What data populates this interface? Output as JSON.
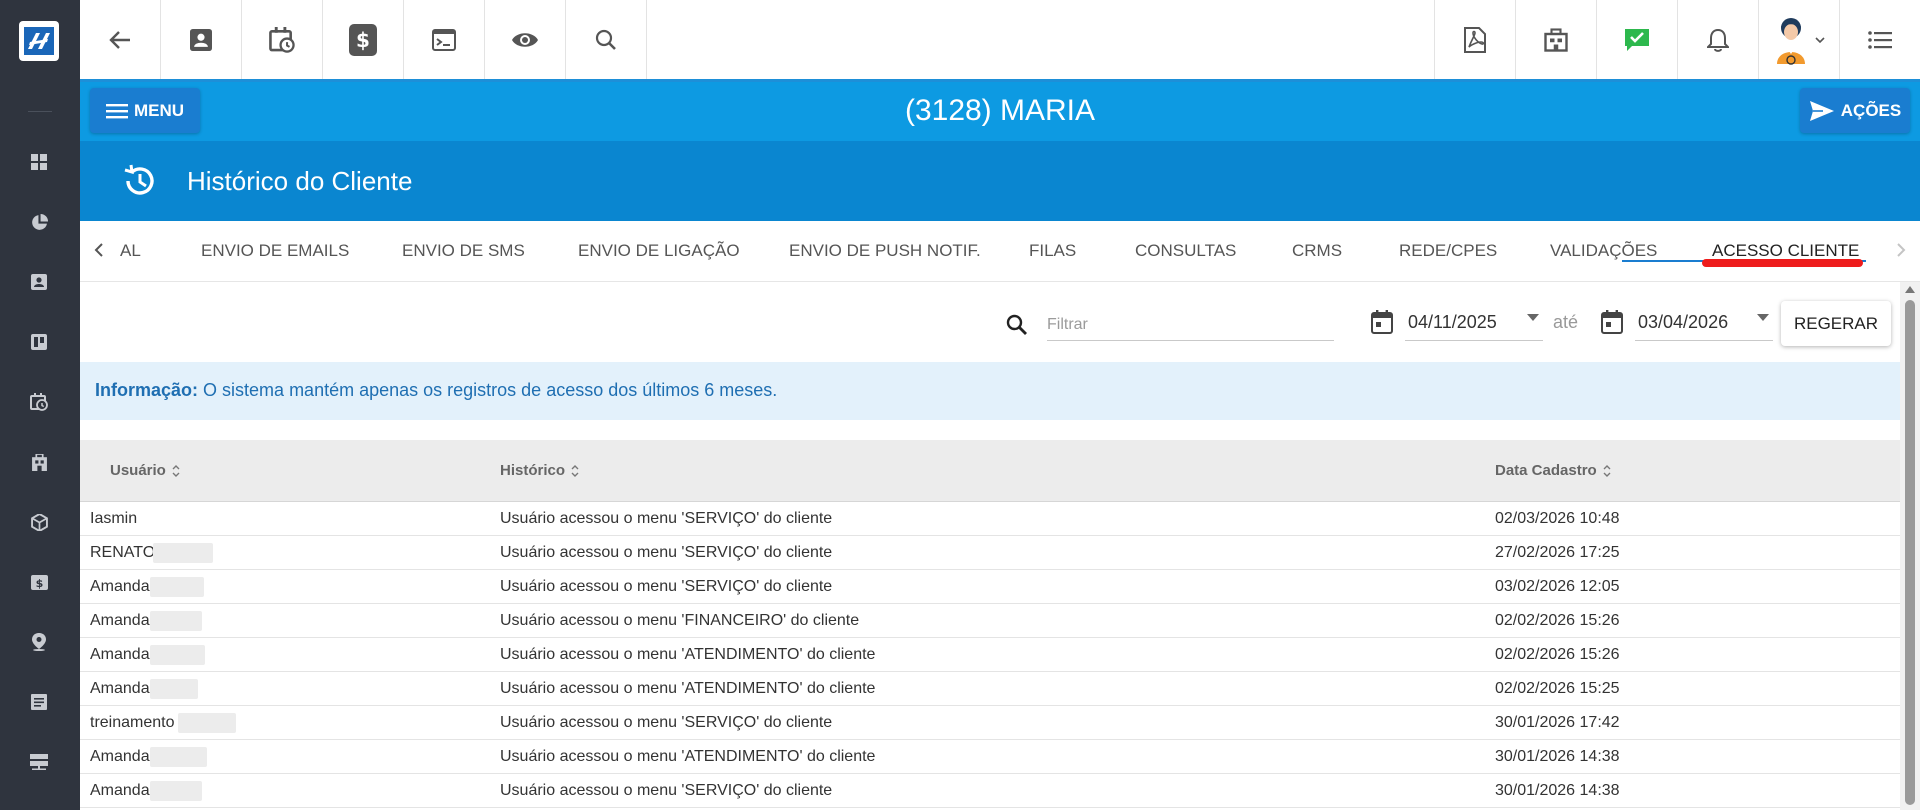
{
  "topbar": {
    "left_buttons": [
      "back-arrow-icon",
      "contact-card-icon",
      "calendar-clock-icon",
      "dollar-icon",
      "terminal-icon",
      "eye-icon",
      "search-icon"
    ],
    "right_buttons": [
      "pdf-icon",
      "building-icon",
      "chat-check-icon",
      "bell-icon",
      "user-avatar",
      "list-icon"
    ]
  },
  "rail": {
    "items": [
      "dashboard-icon",
      "pie-chart-icon",
      "contact-icon",
      "board-icon",
      "calendar-clock-icon",
      "building-icon",
      "box-icon",
      "money-icon",
      "map-pin-icon",
      "document-icon",
      "server-icon"
    ]
  },
  "clientbar": {
    "menu_label": "MENU",
    "title": "(3128) MARIA",
    "actions_label": "AÇÕES"
  },
  "page": {
    "title": "Histórico do Cliente"
  },
  "tabs": [
    {
      "label": "AL"
    },
    {
      "label": "ENVIO DE EMAILS"
    },
    {
      "label": "ENVIO DE SMS"
    },
    {
      "label": "ENVIO DE LIGAÇÃO"
    },
    {
      "label": "ENVIO DE PUSH NOTIF."
    },
    {
      "label": "FILAS"
    },
    {
      "label": "CONSULTAS"
    },
    {
      "label": "CRMS"
    },
    {
      "label": "REDE/CPES"
    },
    {
      "label": "VALIDAÇÕES"
    },
    {
      "label": "ACESSO CLIENTE",
      "active": true
    }
  ],
  "filter": {
    "placeholder": "Filtrar",
    "date_from": "04/11/2025",
    "date_separator": "até",
    "date_to": "03/04/2026",
    "regenerate_label": "REGERAR"
  },
  "info": {
    "label": "Informação:",
    "message": "O sistema mantém apenas os registros de acesso dos últimos 6 meses."
  },
  "table": {
    "columns": [
      "Usuário",
      "Histórico",
      "Data Cadastro"
    ],
    "rows": [
      {
        "user": "Iasmin",
        "history": "Usuário acessou o menu 'SERVIÇO' do cliente",
        "date": "02/03/2026 10:48"
      },
      {
        "user": "RENATO",
        "history": "Usuário acessou o menu 'SERVIÇO' do cliente",
        "date": "27/02/2026 17:25"
      },
      {
        "user": "Amanda",
        "history": "Usuário acessou o menu 'SERVIÇO' do cliente",
        "date": "03/02/2026 12:05"
      },
      {
        "user": "Amanda",
        "history": "Usuário acessou o menu 'FINANCEIRO' do cliente",
        "date": "02/02/2026 15:26"
      },
      {
        "user": "Amanda",
        "history": "Usuário acessou o menu 'ATENDIMENTO' do cliente",
        "date": "02/02/2026 15:26"
      },
      {
        "user": "Amanda",
        "history": "Usuário acessou o menu 'ATENDIMENTO' do cliente",
        "date": "02/02/2026 15:25"
      },
      {
        "user": "treinamento",
        "history": "Usuário acessou o menu 'SERVIÇO' do cliente",
        "date": "30/01/2026 17:42"
      },
      {
        "user": "Amanda",
        "history": "Usuário acessou o menu 'ATENDIMENTO' do cliente",
        "date": "30/01/2026 14:38"
      },
      {
        "user": "Amanda",
        "history": "Usuário acessou o menu 'SERVIÇO' do cliente",
        "date": "30/01/2026 14:38"
      }
    ]
  },
  "colors": {
    "rail": "#2f343e",
    "client_bar": "#0d9ae2",
    "page_header": "#0a86d0",
    "button_blue": "#1a7dd0",
    "info_bg": "#e3f1fb",
    "info_text": "#1f6fb2",
    "active_tab_mark": "#ee1c1c",
    "chat_green": "#2db84d"
  }
}
